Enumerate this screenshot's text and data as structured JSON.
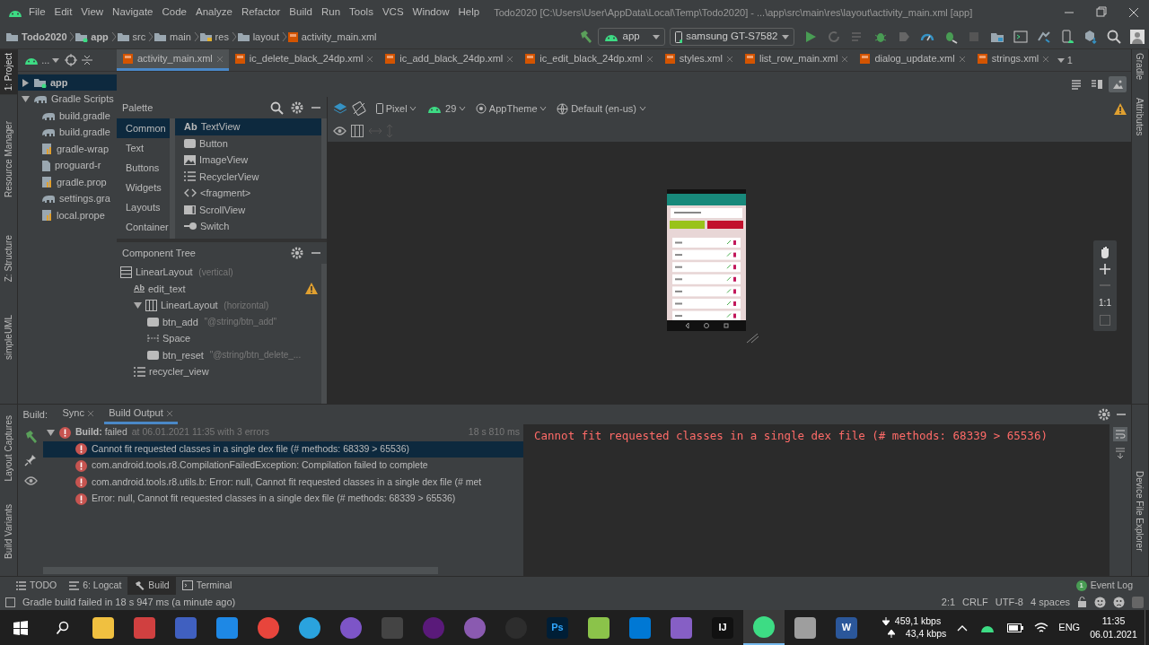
{
  "menu_bar": {
    "items": [
      "File",
      "Edit",
      "View",
      "Navigate",
      "Code",
      "Analyze",
      "Refactor",
      "Build",
      "Run",
      "Tools",
      "VCS",
      "Window",
      "Help"
    ],
    "title": "Todo2020 [C:\\Users\\User\\AppData\\Local\\Temp\\Todo2020] - ...\\app\\src\\main\\res\\layout\\activity_main.xml [app]"
  },
  "breadcrumbs": [
    {
      "label": "Todo2020",
      "kind": "project"
    },
    {
      "label": "app",
      "kind": "module"
    },
    {
      "label": "src",
      "kind": "folder"
    },
    {
      "label": "main",
      "kind": "folder"
    },
    {
      "label": "res",
      "kind": "res"
    },
    {
      "label": "layout",
      "kind": "folder"
    },
    {
      "label": "activity_main.xml",
      "kind": "xml"
    }
  ],
  "run_toolbar": {
    "config": "app",
    "device": "samsung GT-S7582"
  },
  "left_tool_strip": [
    {
      "label": "1: Project",
      "selected": true
    },
    {
      "label": "Resource Manager",
      "selected": false
    },
    {
      "label": "Z: Structure",
      "selected": false
    },
    {
      "label": "simpleUML",
      "selected": false
    }
  ],
  "right_tool_strip": [
    {
      "label": "Gradle"
    },
    {
      "label": "Attributes"
    }
  ],
  "project_panel": {
    "header": "...",
    "tree": [
      {
        "label": "app",
        "kind": "module",
        "selected": true,
        "expanded": false
      },
      {
        "label": "Gradle Scripts",
        "kind": "gradle",
        "selected": false,
        "expanded": true,
        "children": [
          {
            "label": "build.gradle",
            "kind": "gradle"
          },
          {
            "label": "build.gradle",
            "kind": "gradle"
          },
          {
            "label": "gradle-wrap",
            "kind": "properties"
          },
          {
            "label": "proguard-r",
            "kind": "text"
          },
          {
            "label": "gradle.prop",
            "kind": "properties"
          },
          {
            "label": "settings.gra",
            "kind": "gradle"
          },
          {
            "label": "local.prope",
            "kind": "properties"
          }
        ]
      }
    ]
  },
  "editor_tabs": [
    {
      "label": "activity_main.xml",
      "selected": true
    },
    {
      "label": "ic_delete_black_24dp.xml",
      "selected": false
    },
    {
      "label": "ic_add_black_24dp.xml",
      "selected": false
    },
    {
      "label": "ic_edit_black_24dp.xml",
      "selected": false
    },
    {
      "label": "styles.xml",
      "selected": false
    },
    {
      "label": "list_row_main.xml",
      "selected": false
    },
    {
      "label": "dialog_update.xml",
      "selected": false
    },
    {
      "label": "strings.xml",
      "selected": false
    }
  ],
  "tabs_overflow": "1",
  "view_modes": [
    {
      "kind": "code",
      "selected": false
    },
    {
      "kind": "split",
      "selected": false
    },
    {
      "kind": "design",
      "selected": true
    }
  ],
  "palette": {
    "title": "Palette",
    "categories": [
      {
        "label": "Common",
        "selected": true
      },
      {
        "label": "Text",
        "selected": false
      },
      {
        "label": "Buttons",
        "selected": false
      },
      {
        "label": "Widgets",
        "selected": false
      },
      {
        "label": "Layouts",
        "selected": false
      },
      {
        "label": "Container",
        "selected": false
      }
    ],
    "items": [
      {
        "label": "TextView",
        "kind": "text",
        "icon_text": "Ab",
        "selected": true
      },
      {
        "label": "Button",
        "kind": "button",
        "selected": false
      },
      {
        "label": "ImageView",
        "kind": "image",
        "selected": false
      },
      {
        "label": "RecyclerView",
        "kind": "list",
        "selected": false
      },
      {
        "label": "<fragment>",
        "kind": "fragment",
        "selected": false
      },
      {
        "label": "ScrollView",
        "kind": "scroll",
        "selected": false
      },
      {
        "label": "Switch",
        "kind": "switch",
        "selected": false
      }
    ]
  },
  "component_tree": {
    "title": "Component Tree",
    "nodes": [
      {
        "label": "LinearLayout",
        "detail": "(vertical)",
        "kind": "vertical",
        "children": [
          {
            "label": "edit_text",
            "kind": "text",
            "icon_text": "Ab",
            "warning": true
          },
          {
            "label": "LinearLayout",
            "detail": "(horizontal)",
            "kind": "horizontal",
            "expanded": true,
            "children": [
              {
                "label": "btn_add",
                "detail": "\"@string/btn_add\"",
                "kind": "button"
              },
              {
                "label": "Space",
                "kind": "space"
              },
              {
                "label": "btn_reset",
                "detail": "\"@string/btn_delete_...",
                "kind": "button"
              }
            ]
          },
          {
            "label": "recycler_view",
            "kind": "list"
          }
        ]
      }
    ]
  },
  "design_toolbar": {
    "device": "Pixel",
    "api": "29",
    "theme": "AppTheme",
    "locale": "Default (en-us)",
    "warning": true
  },
  "canvas": {
    "zoom_label": "1:1"
  },
  "build_panel": {
    "label": "Build:",
    "tabs": [
      {
        "label": "Sync",
        "selected": false
      },
      {
        "label": "Build Output",
        "selected": true
      }
    ],
    "summary": {
      "status": "**Build:** failed",
      "detail": "at 06.01.2021 11:35 with 3 errors",
      "time": "18 s 810 ms"
    },
    "errors": [
      {
        "text": "Cannot fit requested classes in a single dex file (# methods: 68339 > 65536)",
        "selected": true
      },
      {
        "text": "com.android.tools.r8.CompilationFailedException: Compilation failed to complete",
        "selected": false
      },
      {
        "text": "com.android.tools.r8.utils.b: Error: null, Cannot fit requested classes in a single dex file (# met",
        "selected": false
      },
      {
        "text": "Error: null, Cannot fit requested classes in a single dex file (# methods: 68339 > 65536)",
        "selected": false
      }
    ],
    "console": "Cannot fit requested classes in a single dex file (# methods: 68339 > 65536)"
  },
  "bottom_left_strip": [
    {
      "label": "Layout Captures"
    },
    {
      "label": "Build Variants"
    }
  ],
  "bottom_right_strip": [
    {
      "label": "Device File Explorer"
    }
  ],
  "tool_windows": [
    {
      "label": "TODO",
      "kind": "todo",
      "selected": false
    },
    {
      "label": "6: Logcat",
      "kind": "logcat",
      "selected": false
    },
    {
      "label": "Build",
      "kind": "build",
      "selected": true
    },
    {
      "label": "Terminal",
      "kind": "terminal",
      "selected": false
    }
  ],
  "event_log": {
    "label": "Event Log",
    "count": "1"
  },
  "status_bar": {
    "message": "Gradle build failed in 18 s 947 ms (a minute ago)",
    "items": [
      "2:1",
      "CRLF",
      "UTF-8",
      "4 spaces"
    ]
  },
  "taskbar": {
    "apps": [
      {
        "kind": "folder",
        "selected": false
      },
      {
        "kind": "gallery",
        "selected": false
      },
      {
        "kind": "save",
        "selected": false
      },
      {
        "kind": "remote",
        "selected": false
      },
      {
        "kind": "browser",
        "selected": false
      },
      {
        "kind": "telegram",
        "selected": false
      },
      {
        "kind": "viber",
        "selected": false
      },
      {
        "kind": "git",
        "selected": false
      },
      {
        "kind": "orb",
        "selected": false
      },
      {
        "kind": "cat",
        "selected": false
      },
      {
        "kind": "pen",
        "selected": false
      },
      {
        "kind": "ps",
        "glyph": "Ps",
        "selected": false
      },
      {
        "kind": "notepad",
        "selected": false
      },
      {
        "kind": "code",
        "selected": false
      },
      {
        "kind": "vs",
        "selected": false
      },
      {
        "kind": "ide",
        "glyph": "IJ",
        "selected": false
      },
      {
        "kind": "android",
        "selected": true
      },
      {
        "kind": "database",
        "selected": false
      },
      {
        "kind": "word",
        "glyph": "W",
        "selected": false
      }
    ],
    "network": {
      "down": "459,1 kbps",
      "up": "43,4 kbps"
    },
    "language": "ENG",
    "time": "11:35",
    "date": "06.01.2021"
  }
}
